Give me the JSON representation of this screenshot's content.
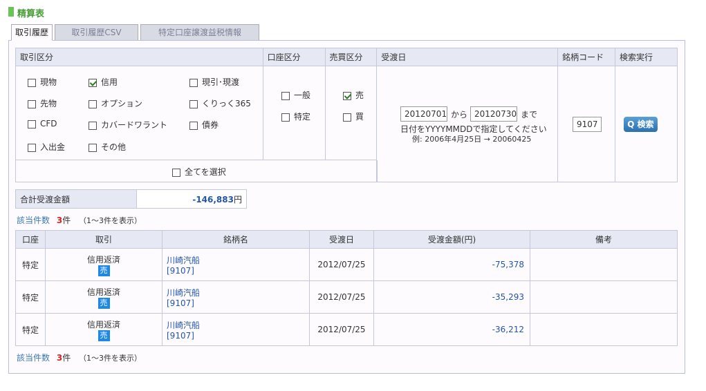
{
  "page_title": "精算表",
  "tabs": [
    "取引履歴",
    "取引履歴CSV",
    "特定口座譲渡益税情報"
  ],
  "search": {
    "headers": {
      "trade_type": "取引区分",
      "account_type": "口座区分",
      "buy_sell": "売買区分",
      "settle_date": "受渡日",
      "code": "銘柄コード",
      "execute": "検索実行"
    },
    "trade_options": [
      "現物",
      "信用",
      "現引･現渡",
      "先物",
      "オプション",
      "くりっく365",
      "CFD",
      "カバードワラント",
      "債券",
      "入出金",
      "その他"
    ],
    "select_all": "全てを選択",
    "account_options": [
      "一般",
      "特定"
    ],
    "buysell_options": [
      "売",
      "買"
    ],
    "date_from": "20120701",
    "from_label": "から",
    "date_to": "20120730",
    "to_label": "まで",
    "date_hint": "日付をYYYYMMDDで指定してください",
    "date_example": "例: 2006年4月25日 → 20060425",
    "code_value": "9107",
    "search_button": "Q 検索"
  },
  "total": {
    "label": "合計受渡金額",
    "value": "-146,883",
    "unit": "円"
  },
  "count": {
    "label": "該当件数",
    "num": "3",
    "unit": "件",
    "range": "（1～3件を表示）"
  },
  "results": {
    "headers": [
      "口座",
      "取引",
      "銘柄名",
      "受渡日",
      "受渡金額(円)",
      "備考"
    ],
    "rows": [
      {
        "account": "特定",
        "trade": "信用返済",
        "side": "売",
        "name": "川崎汽船",
        "code": "[9107]",
        "date": "2012/07/25",
        "amount": "-75,378",
        "note": ""
      },
      {
        "account": "特定",
        "trade": "信用返済",
        "side": "売",
        "name": "川崎汽船",
        "code": "[9107]",
        "date": "2012/07/25",
        "amount": "-35,293",
        "note": ""
      },
      {
        "account": "特定",
        "trade": "信用返済",
        "side": "売",
        "name": "川崎汽船",
        "code": "[9107]",
        "date": "2012/07/25",
        "amount": "-36,212",
        "note": ""
      }
    ]
  }
}
